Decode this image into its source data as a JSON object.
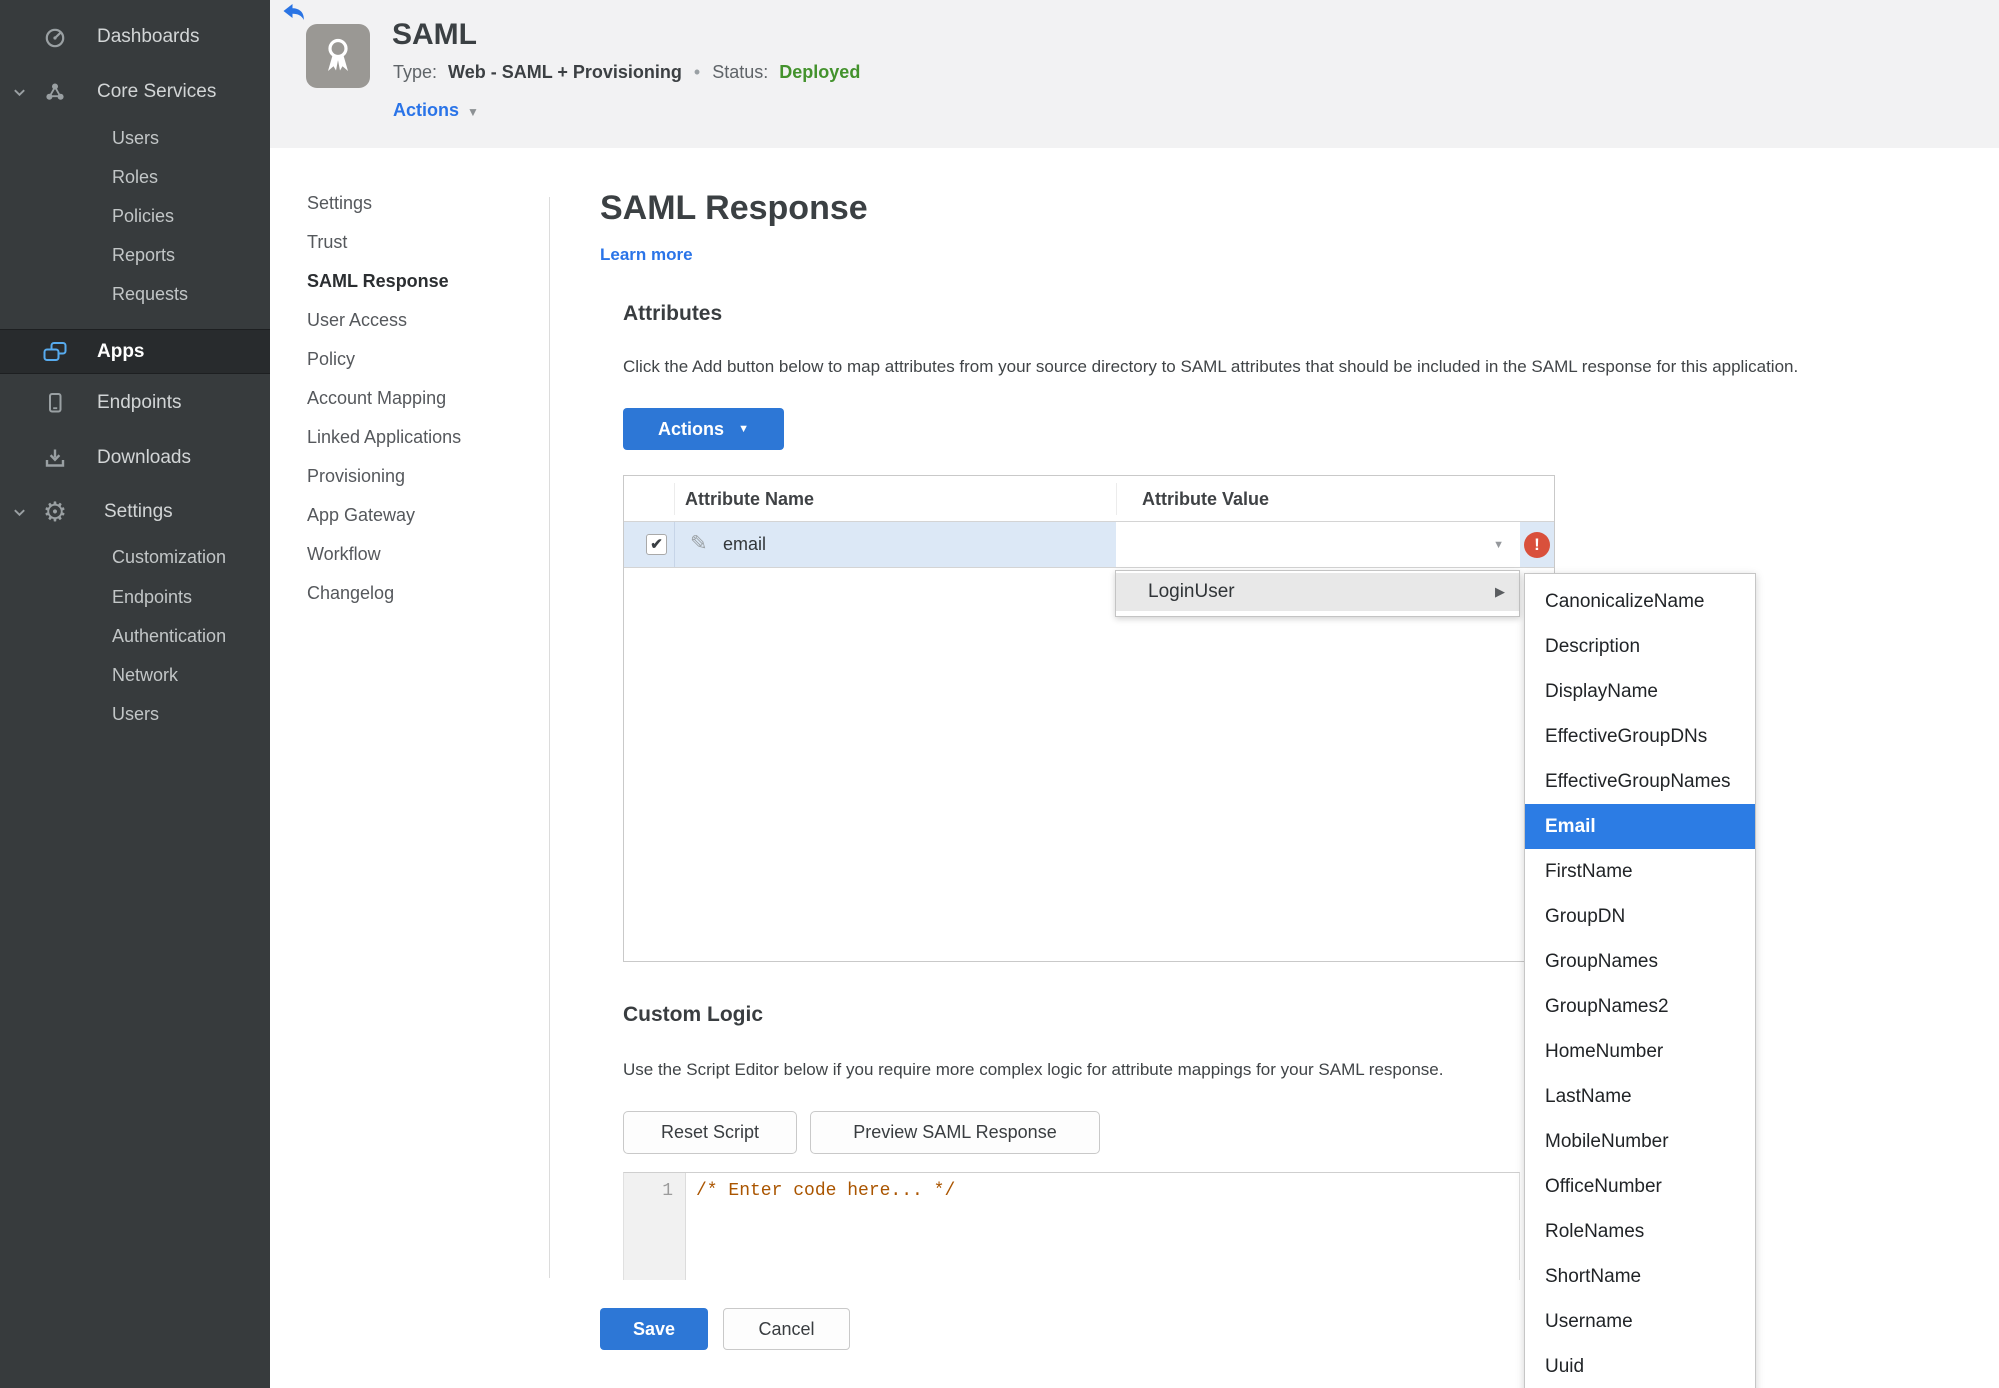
{
  "sidebar": {
    "dashboards": "Dashboards",
    "core_services": "Core Services",
    "core_children": [
      "Users",
      "Roles",
      "Policies",
      "Reports",
      "Requests"
    ],
    "apps": "Apps",
    "endpoints": "Endpoints",
    "downloads": "Downloads",
    "settings": "Settings",
    "settings_children": [
      "Customization",
      "Endpoints",
      "Authentication",
      "Network",
      "Users"
    ]
  },
  "header": {
    "title": "SAML",
    "type_label": "Type:",
    "type_value": "Web - SAML + Provisioning",
    "separator": "•",
    "status_label": "Status:",
    "status_value": "Deployed",
    "actions_label": "Actions"
  },
  "subnav": {
    "items": [
      "Settings",
      "Trust",
      "SAML Response",
      "User Access",
      "Policy",
      "Account Mapping",
      "Linked Applications",
      "Provisioning",
      "App Gateway",
      "Workflow",
      "Changelog"
    ],
    "active": "SAML Response"
  },
  "main": {
    "title": "SAML Response",
    "learn_more": "Learn more",
    "attributes": {
      "heading": "Attributes",
      "description": "Click the Add button below to map attributes from your source directory to SAML attributes that should be included in the SAML response for this application.",
      "actions_button": "Actions",
      "table": {
        "columns": [
          "Attribute Name",
          "Attribute Value"
        ],
        "row": {
          "name": "email",
          "value": "",
          "checked": true,
          "error": true
        }
      }
    },
    "value_menu": {
      "label": "LoginUser"
    },
    "attribute_submenu": {
      "items": [
        "CanonicalizeName",
        "Description",
        "DisplayName",
        "EffectiveGroupDNs",
        "EffectiveGroupNames",
        "Email",
        "FirstName",
        "GroupDN",
        "GroupNames",
        "GroupNames2",
        "HomeNumber",
        "LastName",
        "MobileNumber",
        "OfficeNumber",
        "RoleNames",
        "ShortName",
        "Username",
        "Uuid"
      ],
      "selected": "Email"
    },
    "custom_logic": {
      "heading": "Custom Logic",
      "description": "Use the Script Editor below if you require more complex logic for attribute mappings for your SAML response.",
      "reset_button": "Reset Script",
      "preview_button": "Preview SAML Response",
      "editor": {
        "line_number": "1",
        "code": "/* Enter code here... */"
      }
    },
    "save_button": "Save",
    "cancel_button": "Cancel"
  },
  "colors": {
    "accent_blue": "#2d77d6",
    "selection_blue": "#2c7ce4",
    "link_blue": "#2a74e8",
    "status_green": "#43922c",
    "error_red": "#d9503c",
    "sidebar_bg": "#373b3d",
    "row_highlight": "#dce8f6"
  }
}
